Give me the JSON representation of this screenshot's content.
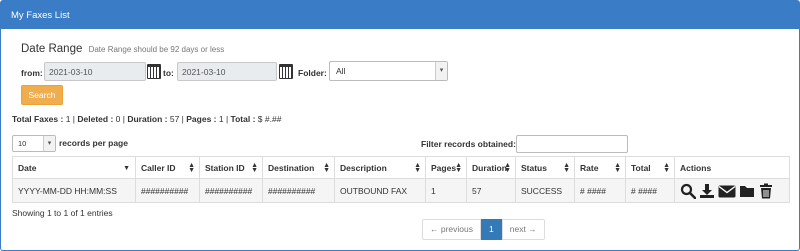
{
  "header": {
    "title": "My Faxes List"
  },
  "date_range": {
    "title": "Date Range",
    "note": "Date Range should be 92 days or less",
    "from_label": "from:",
    "from_value": "2021-03-10",
    "to_label": "to:",
    "to_value": "2021-03-10",
    "folder_label": "Folder:",
    "folder_value": "All"
  },
  "search_label": "Search",
  "totals": {
    "faxes_label": "Total Faxes :",
    "faxes": "1",
    "deleted_label": "Deleted :",
    "deleted": "0",
    "duration_label": "Duration :",
    "duration": "57",
    "pages_label": "Pages :",
    "pages": "1",
    "total_label": "Total :",
    "total": "$ #.##"
  },
  "records_per_page": {
    "value": "10",
    "label": "records per page"
  },
  "filter": {
    "label": "Filter records obtained:",
    "value": ""
  },
  "table": {
    "columns": [
      "Date",
      "Caller ID",
      "Station ID",
      "Destination",
      "Description",
      "Pages",
      "Duration",
      "Status",
      "Rate",
      "Total",
      "Actions"
    ],
    "rows": [
      [
        "YYYY-MM-DD HH:MM:SS",
        "##########",
        "##########",
        "##########",
        "OUTBOUND FAX",
        "1",
        "57",
        "SUCCESS",
        "# ####",
        "# ####"
      ]
    ]
  },
  "actions": [
    "search-icon",
    "download-icon",
    "envelope-icon",
    "folder-icon",
    "trash-icon"
  ],
  "showing": "Showing 1 to 1 of 1 entries",
  "pagination": {
    "previous": "← previous",
    "page": "1",
    "next": "next →"
  },
  "colors": {
    "header": "#3a7cc5",
    "search_button": "#f0ad4e",
    "active_page": "#337ab7"
  }
}
